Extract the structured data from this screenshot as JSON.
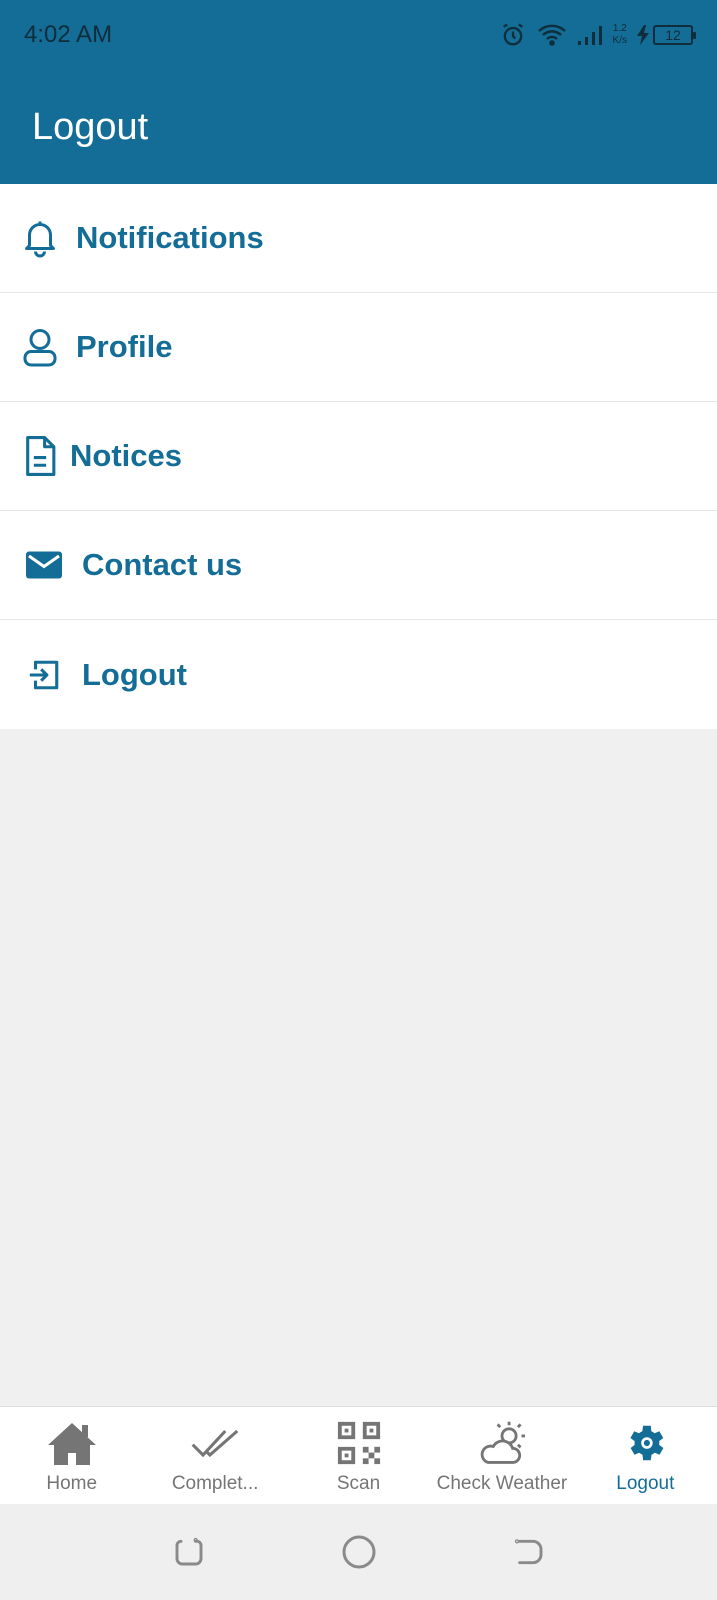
{
  "status_bar": {
    "time": "4:02 AM",
    "net_speed_value": "1.2",
    "net_speed_unit": "K/s",
    "battery_level": "12",
    "icons": [
      "alarm-icon",
      "wifi-icon",
      "signal-icon",
      "charging-icon",
      "battery-icon"
    ]
  },
  "app_bar": {
    "title": "Logout"
  },
  "menu": {
    "items": [
      {
        "label": "Notifications",
        "icon": "bell-icon"
      },
      {
        "label": "Profile",
        "icon": "user-icon"
      },
      {
        "label": "Notices",
        "icon": "document-icon"
      },
      {
        "label": "Contact us",
        "icon": "mail-icon"
      },
      {
        "label": "Logout",
        "icon": "logout-icon"
      }
    ]
  },
  "tab_bar": {
    "tabs": [
      {
        "label": "Home",
        "icon": "home-icon",
        "active": false
      },
      {
        "label": "Complet...",
        "icon": "double-check-icon",
        "active": false
      },
      {
        "label": "Scan",
        "icon": "qr-code-icon",
        "active": false
      },
      {
        "label": "Check Weather",
        "icon": "weather-icon",
        "active": false
      },
      {
        "label": "Logout",
        "icon": "settings-gear-icon",
        "active": true
      }
    ]
  },
  "nav_bar": {
    "buttons": [
      "recents-icon",
      "home-circle-icon",
      "back-icon"
    ]
  },
  "colors": {
    "primary": "#146d96",
    "background": "#f0f0f0",
    "inactive_tab": "#757575"
  }
}
